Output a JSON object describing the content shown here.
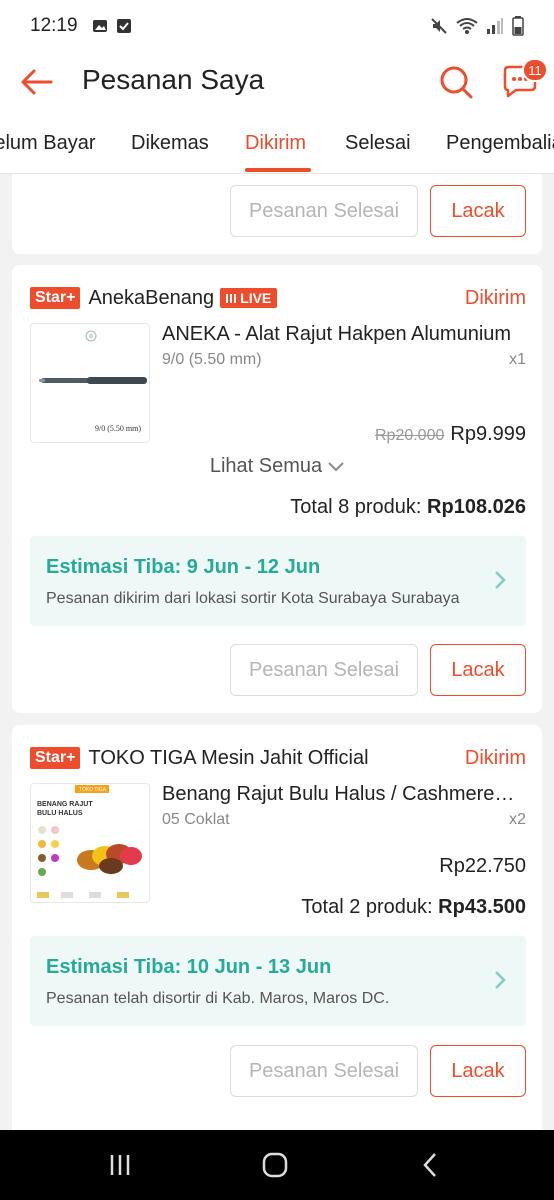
{
  "status_bar": {
    "time": "12:19"
  },
  "header": {
    "title": "Pesanan Saya",
    "chat_badge": "11"
  },
  "tabs": [
    {
      "label": "Belum Bayar"
    },
    {
      "label": "Dikemas"
    },
    {
      "label": "Dikirim"
    },
    {
      "label": "Selesai"
    },
    {
      "label": "Pengembalian"
    }
  ],
  "buttons": {
    "complete": "Pesanan Selesai",
    "track": "Lacak"
  },
  "orders": [
    {
      "badge": "Star+",
      "shop": "AnekaBenang",
      "live": "LIVE",
      "status": "Dikirim",
      "product": {
        "name": "ANEKA - Alat Rajut Hakpen Alumunium",
        "variant": "9/0 (5.50 mm)",
        "qty": "x1",
        "price_old": "Rp20.000",
        "price": "Rp9.999",
        "thumb_caption": "9/0 (5.50 mm)"
      },
      "see_all": "Lihat Semua",
      "total_label": "Total 8 produk:",
      "total_value": "Rp108.026",
      "eta_title": "Estimasi Tiba: 9 Jun - 12 Jun",
      "eta_desc": "Pesanan dikirim dari lokasi sortir Kota Surabaya  Surabaya"
    },
    {
      "badge": "Star+",
      "shop": "TOKO TIGA Mesin Jahit Official",
      "status": "Dikirim",
      "product": {
        "name": "Benang Rajut Bulu Halus / Cashmere Yarn",
        "variant": "05 Coklat",
        "qty": "x2",
        "price": "Rp22.750",
        "thumb_tag": "TOKO TIGA",
        "thumb_title_1": "BENANG RAJUT",
        "thumb_title_2": "BULU HALUS"
      },
      "total_label": "Total 2 produk:",
      "total_value": "Rp43.500",
      "eta_title": "Estimasi Tiba: 10 Jun - 13 Jun",
      "eta_desc": "Pesanan telah disortir di Kab. Maros, Maros DC."
    }
  ],
  "icons": {
    "back": "arrow-left-icon",
    "search": "search-icon",
    "chat": "chat-icon",
    "see_all": "chevron-down-icon",
    "eta": "chevron-right-icon"
  },
  "colors": {
    "accent": "#ee4d2d",
    "eta_green": "#26aa99",
    "eta_bg": "#eef8f6"
  }
}
